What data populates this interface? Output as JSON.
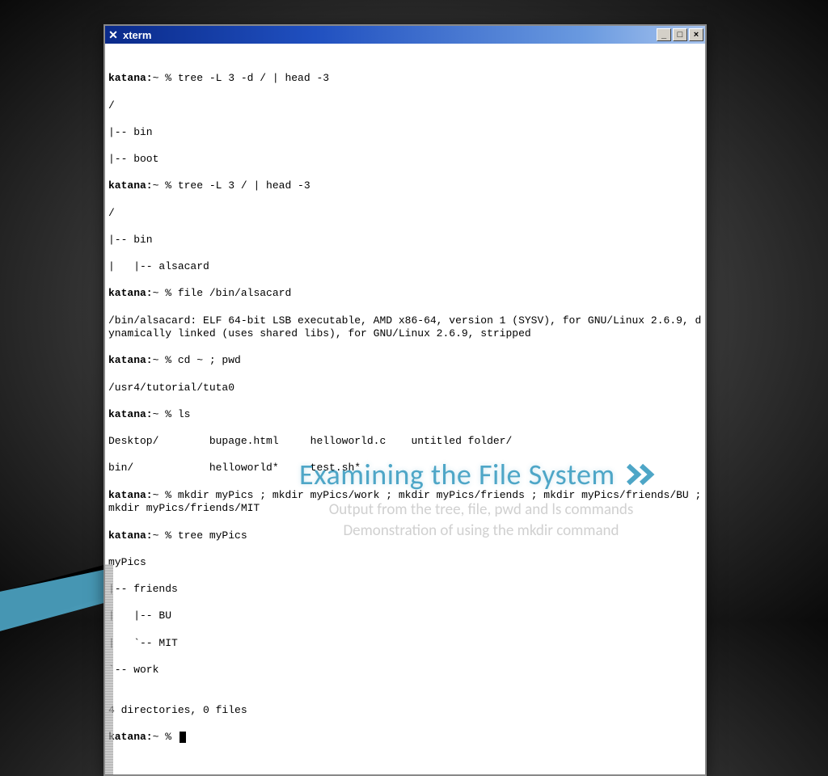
{
  "window": {
    "title": "xterm"
  },
  "terminal": {
    "prompt": "katana:",
    "home": "~",
    "pct": " % ",
    "cmd1": "tree -L 3 -d / | head -3",
    "out1a": "/",
    "out1b": "|-- bin",
    "out1c": "|-- boot",
    "cmd2": "tree -L 3 / | head -3",
    "out2a": "/",
    "out2b": "|-- bin",
    "out2c": "|   |-- alsacard",
    "cmd3": "file /bin/alsacard",
    "out3": "/bin/alsacard: ELF 64-bit LSB executable, AMD x86-64, version 1 (SYSV), for GNU/Linux 2.6.9, dynamically linked (uses shared libs), for GNU/Linux 2.6.9, stripped",
    "cmd4": "cd ~ ; pwd",
    "out4": "/usr4/tutorial/tuta0",
    "cmd5": "ls",
    "out5a": "Desktop/        bupage.html     helloworld.c    untitled folder/",
    "out5b": "bin/            helloworld*     test.sh*",
    "cmd6": "mkdir myPics ; mkdir myPics/work ; mkdir myPics/friends ; mkdir myPics/friends/BU ; mkdir myPics/friends/MIT",
    "cmd7": "tree myPics",
    "out7a": "myPics",
    "out7b": "|-- friends",
    "out7c": "|   |-- BU",
    "out7d": "|   `-- MIT",
    "out7e": "`-- work",
    "out7blank": "",
    "out7f": "4 directories, 0 files"
  },
  "slide": {
    "title": "Examining the File System",
    "subtitle1": "Output from the tree, file, pwd and ls commands",
    "subtitle2": "Demonstration of using the mkdir command"
  }
}
